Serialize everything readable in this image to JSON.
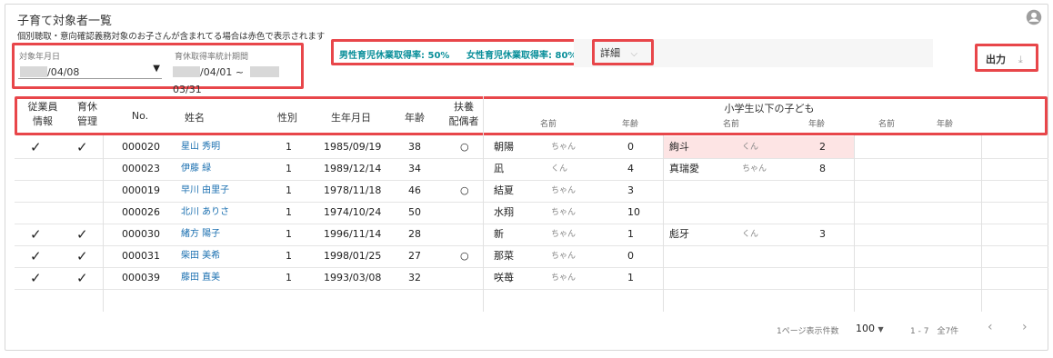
{
  "page": {
    "title": "子育て対象者一覧",
    "note": "個別聴取・意向確認義務対象のお子さんが含まれてる場合は赤色で表示されます"
  },
  "filters": {
    "target_date_label": "対象年月日",
    "target_date_value": "/04/08",
    "period_label": "育休取得率統計期間",
    "period_start": "/04/01 ~",
    "period_end": "03/31"
  },
  "rates": {
    "male": "男性育児休業取得率: 50%",
    "female": "女性育児休業取得率: 80%"
  },
  "detail_label": "詳細",
  "export_label": "出力",
  "headers": {
    "employee_info": [
      "従業員",
      "情報"
    ],
    "leave_mgmt": [
      "育休",
      "管理"
    ],
    "no": "No.",
    "name": "姓名",
    "gender": "性別",
    "birthdate": "生年月日",
    "age": "年齢",
    "spouse": [
      "扶養",
      "配偶者"
    ],
    "children": "小学生以下の子ども",
    "child_name": "名前",
    "child_age": "年齢"
  },
  "rows": [
    {
      "emp": "✓",
      "leave": "✓",
      "no": "000020",
      "name": "星山 秀明",
      "gender": "1",
      "birth": "1985/09/19",
      "age": "38",
      "spouse": "○",
      "c1_name": "朝陽",
      "c1_suffix": "ちゃん",
      "c1_age": "0",
      "c2_name": "絢斗",
      "c2_suffix": "くん",
      "c2_age": "2",
      "c2_red": true
    },
    {
      "emp": "",
      "leave": "",
      "no": "000023",
      "name": "伊藤 緑",
      "gender": "1",
      "birth": "1989/12/14",
      "age": "34",
      "spouse": "",
      "c1_name": "凪",
      "c1_suffix": "くん",
      "c1_age": "4",
      "c2_name": "真瑞愛",
      "c2_suffix": "ちゃん",
      "c2_age": "8",
      "c2_red": false
    },
    {
      "emp": "",
      "leave": "",
      "no": "000019",
      "name": "早川 由里子",
      "gender": "1",
      "birth": "1978/11/18",
      "age": "46",
      "spouse": "○",
      "c1_name": "結夏",
      "c1_suffix": "ちゃん",
      "c1_age": "3",
      "c2_name": "",
      "c2_suffix": "",
      "c2_age": "",
      "c2_red": false
    },
    {
      "emp": "",
      "leave": "",
      "no": "000026",
      "name": "北川 ありさ",
      "gender": "1",
      "birth": "1974/10/24",
      "age": "50",
      "spouse": "",
      "c1_name": "水翔",
      "c1_suffix": "ちゃん",
      "c1_age": "10",
      "c2_name": "",
      "c2_suffix": "",
      "c2_age": "",
      "c2_red": false
    },
    {
      "emp": "✓",
      "leave": "✓",
      "no": "000030",
      "name": "緒方 陽子",
      "gender": "1",
      "birth": "1996/11/14",
      "age": "28",
      "spouse": "",
      "c1_name": "新",
      "c1_suffix": "ちゃん",
      "c1_age": "1",
      "c2_name": "彪牙",
      "c2_suffix": "くん",
      "c2_age": "3",
      "c2_red": false
    },
    {
      "emp": "✓",
      "leave": "✓",
      "no": "000031",
      "name": "柴田 美希",
      "gender": "1",
      "birth": "1998/01/25",
      "age": "27",
      "spouse": "○",
      "c1_name": "那菜",
      "c1_suffix": "ちゃん",
      "c1_age": "0",
      "c2_name": "",
      "c2_suffix": "",
      "c2_age": "",
      "c2_red": false
    },
    {
      "emp": "✓",
      "leave": "✓",
      "no": "000039",
      "name": "藤田 直美",
      "gender": "1",
      "birth": "1993/03/08",
      "age": "32",
      "spouse": "",
      "c1_name": "咲苺",
      "c1_suffix": "ちゃん",
      "c1_age": "1",
      "c2_name": "",
      "c2_suffix": "",
      "c2_age": "",
      "c2_red": false
    }
  ],
  "pagination": {
    "per_page_label": "1ページ表示件数",
    "per_page_value": "100",
    "range": "1 - 7",
    "total": "全7件"
  },
  "colors": {
    "accent": "#0a8f9a",
    "highlight_border": "#e8464a",
    "red_cell": "#fde4e4",
    "name_link": "#1a6fb0"
  },
  "icons": {
    "avatar": "account-circle-icon",
    "dropdown": "triangle-down-icon",
    "detail_chevron": "chevron-down-icon",
    "export": "download-icon",
    "prev": "chevron-left-icon",
    "next": "chevron-right-icon"
  }
}
